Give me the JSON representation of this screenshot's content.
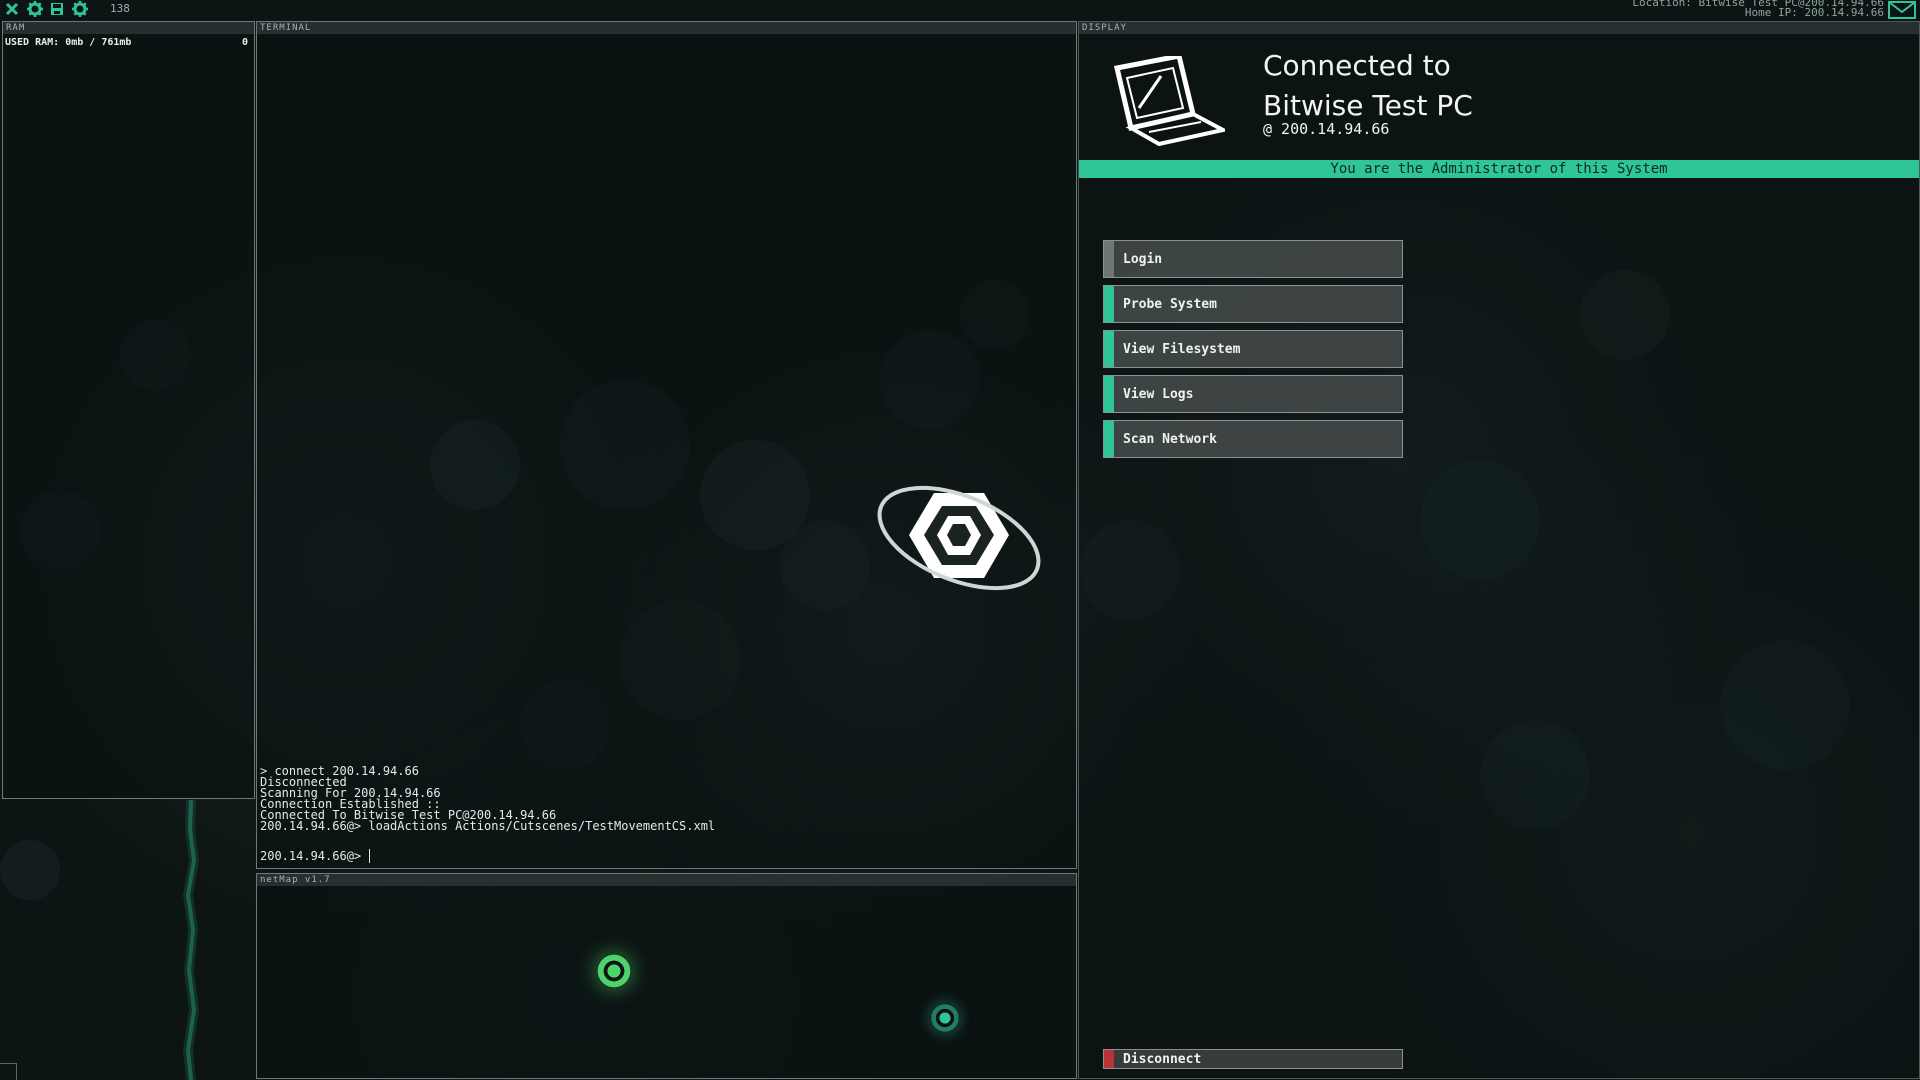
{
  "topbar": {
    "icons": [
      "close-icon",
      "settings-icon",
      "save-icon",
      "gear-icon"
    ],
    "money": "138",
    "location": "Location: Bitwise Test PC@200.14.94.66",
    "home_ip": "Home IP: 200.14.94.66"
  },
  "ram": {
    "title": "RAM",
    "usage": "USED RAM: 0mb / 761mb",
    "count": "0"
  },
  "terminal": {
    "title": "TERMINAL",
    "lines": [
      "> connect 200.14.94.66",
      "Disconnected",
      "Scanning For 200.14.94.66",
      "Connection Established ::",
      "Connected To Bitwise Test PC@200.14.94.66",
      "200.14.94.66@> loadActions Actions/Cutscenes/TestMovementCS.xml"
    ],
    "prompt": "200.14.94.66@>"
  },
  "netmap": {
    "title": "netMap v1.7",
    "nodes": [
      "home-node",
      "target-node"
    ]
  },
  "display": {
    "title": "DISPLAY",
    "connected_label": "Connected to",
    "host_name": "Bitwise Test PC",
    "host_ip": "@  200.14.94.66",
    "admin_banner": "You are the Administrator of this System",
    "menu": [
      {
        "label": "Login",
        "accent": "#6f7776"
      },
      {
        "label": "Probe System",
        "accent": "#2fc596"
      },
      {
        "label": "View Filesystem",
        "accent": "#2fc596"
      },
      {
        "label": "View Logs",
        "accent": "#2fc596"
      },
      {
        "label": "Scan Network",
        "accent": "#2fc596"
      }
    ],
    "disconnect_label": "Disconnect"
  },
  "colors": {
    "accent": "#2fc596",
    "danger": "#b8323a",
    "panel_border": "#6d7b78"
  }
}
